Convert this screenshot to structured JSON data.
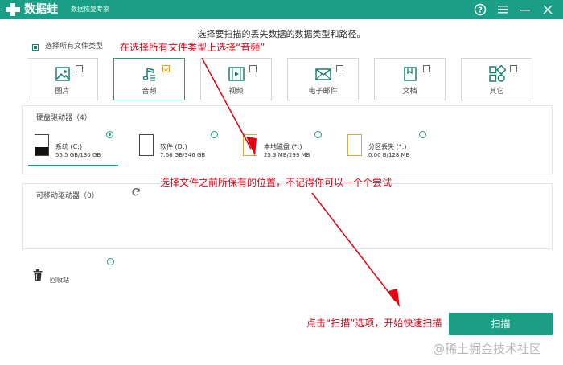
{
  "app": {
    "title": "数据蛙",
    "subtitle": "数据恢复专家",
    "brand_color": "#1a9e86"
  },
  "titlebar_icons": [
    "help-icon",
    "menu-icon",
    "minimize-icon",
    "close-icon"
  ],
  "main": {
    "prompt": "选择要扫描的丢失数据的数据类型和路径。",
    "select_all_label": "选择所有文件类型"
  },
  "file_types": [
    {
      "label": "图片",
      "icon": "image-icon",
      "checked": false
    },
    {
      "label": "音频",
      "icon": "music-icon",
      "checked": true
    },
    {
      "label": "视频",
      "icon": "video-icon",
      "checked": false
    },
    {
      "label": "电子邮件",
      "icon": "mail-icon",
      "checked": false
    },
    {
      "label": "文档",
      "icon": "document-icon",
      "checked": false
    },
    {
      "label": "其它",
      "icon": "other-icon",
      "checked": false
    }
  ],
  "drives_section": {
    "title": "硬盘驱动器（4）",
    "drives": [
      {
        "name": "系统 (C:)",
        "size": "55.5 GB/130 GB",
        "selected": true
      },
      {
        "name": "软件 (D:)",
        "size": "7.66 GB/346 GB",
        "selected": false
      },
      {
        "name": "本地磁盘 (*:)",
        "size": "25.3 MB/299 MB",
        "selected": false
      },
      {
        "name": "分区丢失 (*:)",
        "size": "0.00  B/128 MB",
        "selected": false
      }
    ]
  },
  "removable_section": {
    "title": "可移动驱动器（0）"
  },
  "recycle_bin": {
    "label": "回收站"
  },
  "scan_button": {
    "label": "扫描"
  },
  "annotations": {
    "select_audio": "在选择所有文件类型上选择“音频”",
    "select_location": "选择文件之前所保有的位置，不记得你可以一个个尝试",
    "click_scan": "点击“扫描”选项，开始快速扫描",
    "color": "#e60012"
  },
  "watermark": "@稀土掘金技术社区"
}
